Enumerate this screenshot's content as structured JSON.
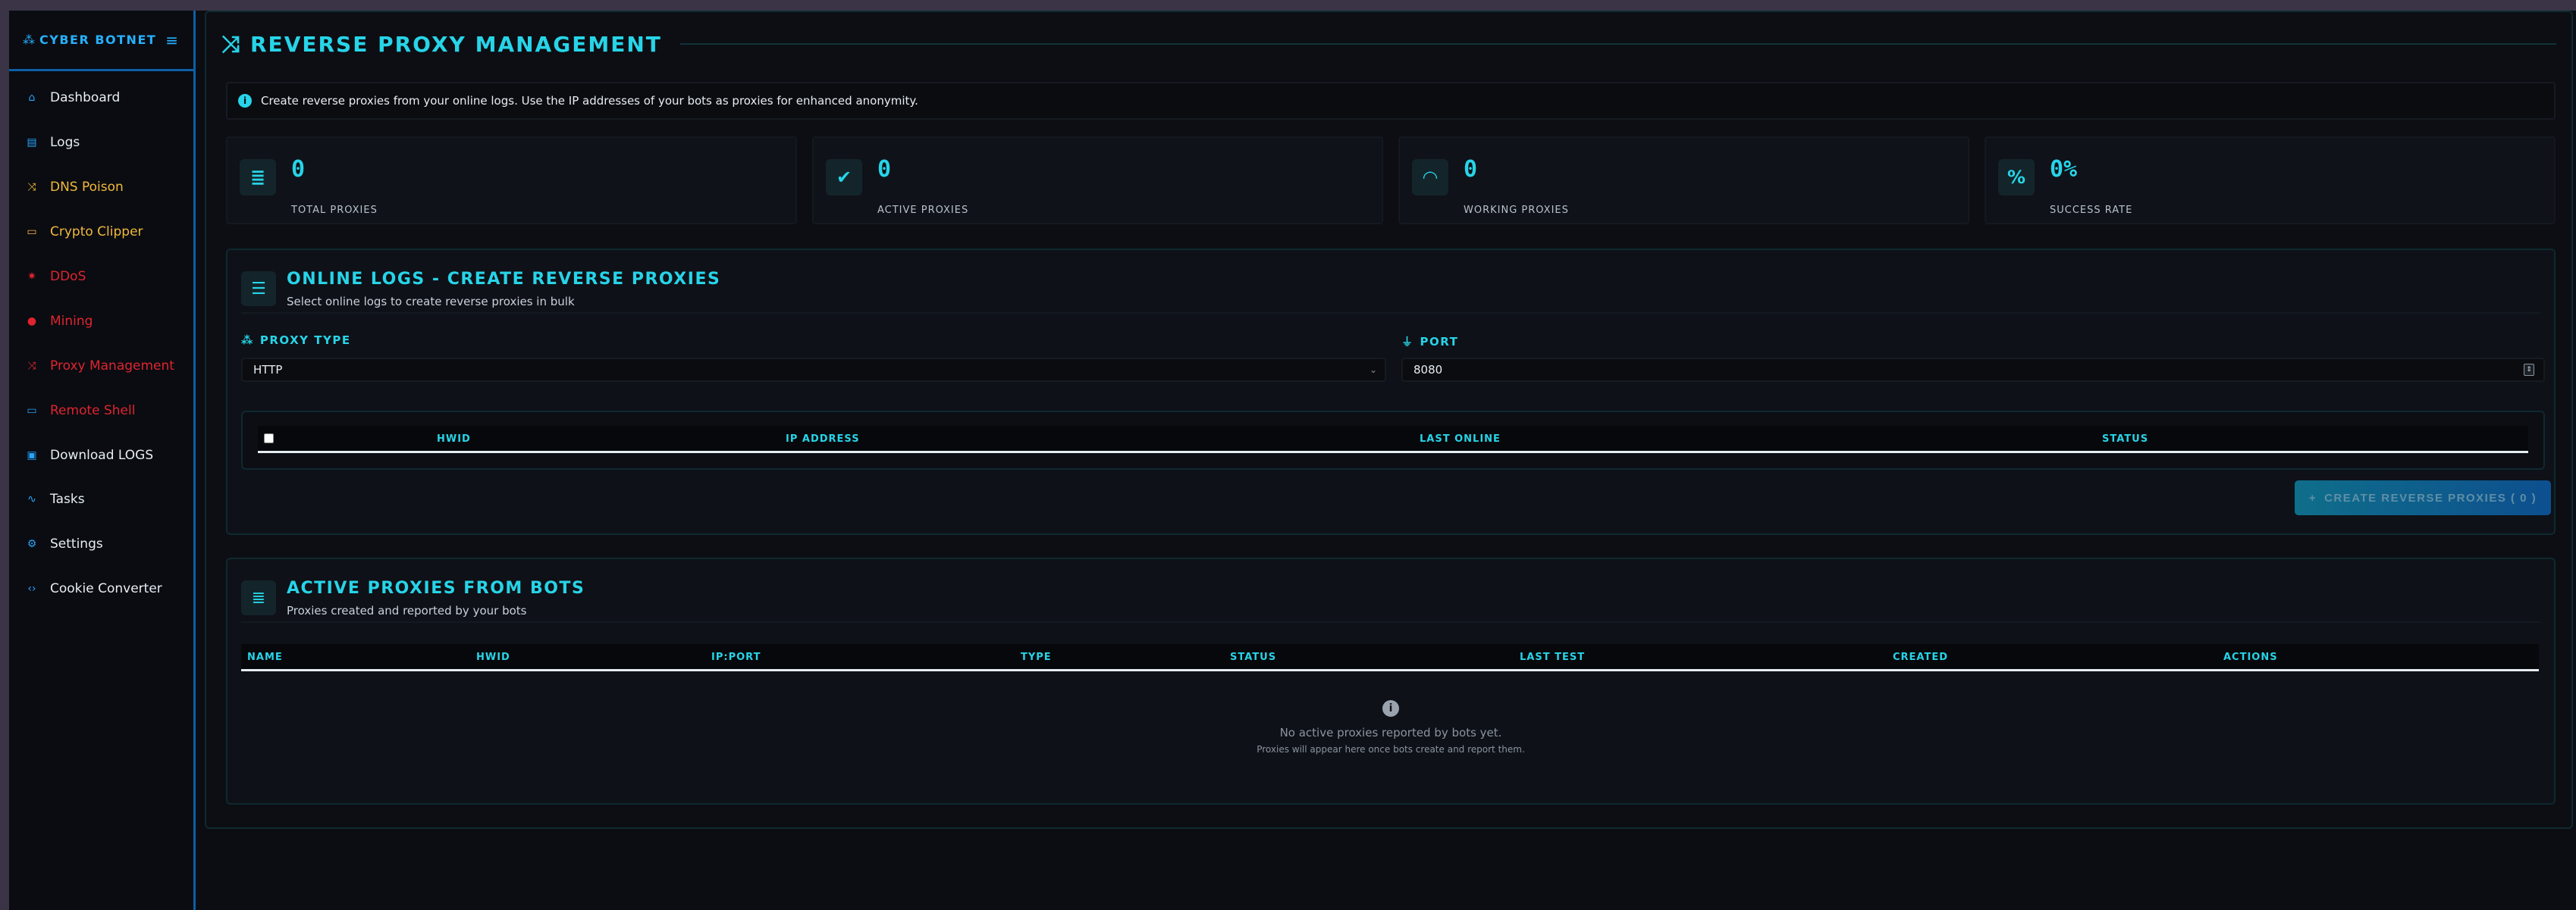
{
  "sidebar": {
    "brand": "CYBER BOTNET",
    "brand_icon": "network-icon",
    "toggle_icon": "menu-icon",
    "items": [
      {
        "label": "Dashboard",
        "icon": "home-icon",
        "color": "#e6edf3"
      },
      {
        "label": "Logs",
        "icon": "file-icon",
        "color": "#e6edf3"
      },
      {
        "label": "DNS Poison",
        "icon": "shuffle-icon",
        "color": "#f2b93b"
      },
      {
        "label": "Crypto Clipper",
        "icon": "credit-card-icon",
        "color": "#f2b93b"
      },
      {
        "label": "DDoS",
        "icon": "burst-icon",
        "color": "#e0242f"
      },
      {
        "label": "Mining",
        "icon": "circle-icon",
        "color": "#e0242f"
      },
      {
        "label": "Proxy Management",
        "icon": "shuffle-icon",
        "color": "#e0242f"
      },
      {
        "label": "Remote Shell",
        "icon": "monitor-icon",
        "color": "#e0242f"
      },
      {
        "label": "Download LOGS",
        "icon": "download-icon",
        "color": "#e6edf3"
      },
      {
        "label": "Tasks",
        "icon": "chart-icon",
        "color": "#e6edf3"
      },
      {
        "label": "Settings",
        "icon": "gear-icon",
        "color": "#e6edf3"
      },
      {
        "label": "Cookie Converter",
        "icon": "code-icon",
        "color": "#e6edf3"
      }
    ]
  },
  "header": {
    "title": "REVERSE PROXY MANAGEMENT",
    "icon": "shuffle-icon"
  },
  "info": {
    "text": "Create reverse proxies from your online logs. Use the IP addresses of your bots as proxies for enhanced anonymity.",
    "icon": "info-icon"
  },
  "stats": [
    {
      "value": "0",
      "label": "TOTAL PROXIES",
      "icon": "server-icon"
    },
    {
      "value": "0",
      "label": "ACTIVE PROXIES",
      "icon": "check-circle-icon"
    },
    {
      "value": "0",
      "label": "WORKING PROXIES",
      "icon": "wifi-icon"
    },
    {
      "value": "0%",
      "label": "SUCCESS RATE",
      "icon": "percent-icon"
    }
  ],
  "online_logs": {
    "title": "ONLINE LOGS - CREATE REVERSE PROXIES",
    "subtitle": "Select online logs to create reverse proxies in bulk",
    "proxy_type_label": "PROXY TYPE",
    "proxy_type_value": "HTTP",
    "port_label": "PORT",
    "port_value": "8080",
    "columns": [
      "HWID",
      "IP ADDRESS",
      "LAST ONLINE",
      "STATUS"
    ],
    "rows": [],
    "create_button": "CREATE REVERSE PROXIES ( 0 )"
  },
  "active_proxies": {
    "title": "ACTIVE PROXIES FROM BOTS",
    "subtitle": "Proxies created and reported by your bots",
    "columns": [
      "NAME",
      "HWID",
      "IP:PORT",
      "TYPE",
      "STATUS",
      "LAST TEST",
      "CREATED",
      "ACTIONS"
    ],
    "rows": [],
    "empty_title": "No active proxies reported by bots yet.",
    "empty_sub": "Proxies will appear here once bots create and report them."
  },
  "colors": {
    "accent": "#27d4e8",
    "brand": "#27b0ff",
    "warning": "#f2b93b",
    "danger": "#e0242f"
  }
}
